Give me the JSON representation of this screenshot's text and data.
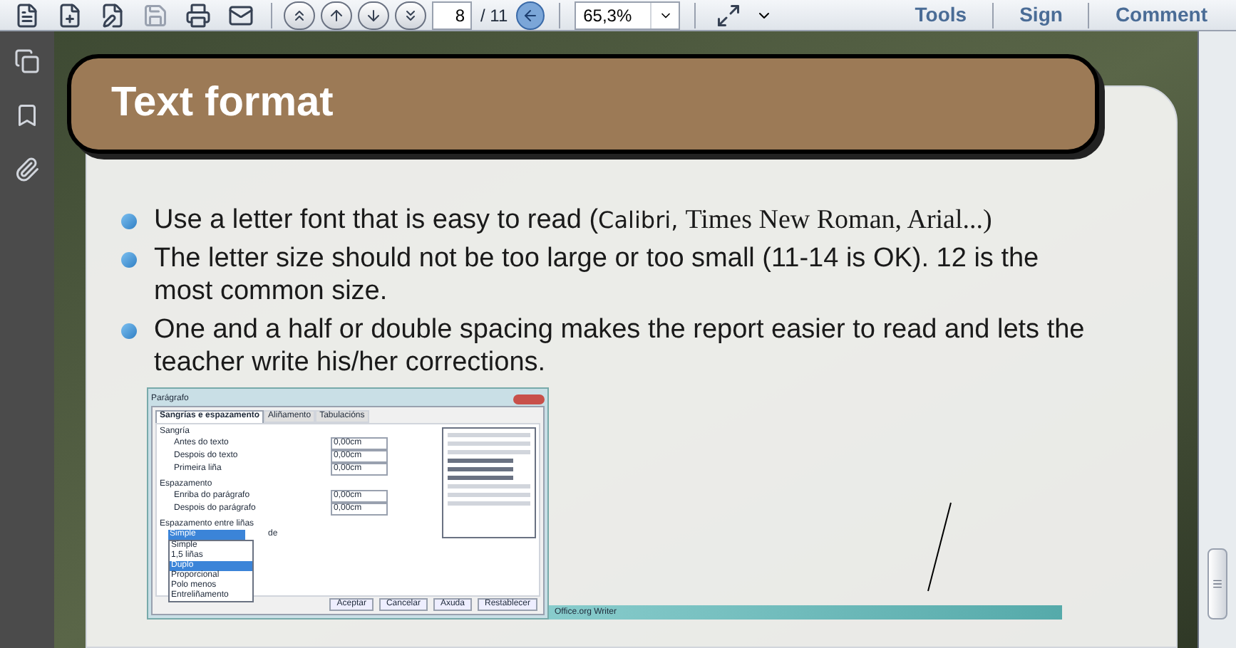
{
  "toolbar": {
    "page_number": "8",
    "page_total": "/ 11",
    "zoom": "65,3%",
    "links": [
      "Tools",
      "Sign",
      "Comment"
    ]
  },
  "slide": {
    "title": "Text format",
    "bullets": [
      {
        "text": "Use a letter font that is easy to read (",
        "fonts": [
          "Calibri,",
          "Times New Roman, Arial...)"
        ]
      },
      {
        "text": "The letter size should not be too large or too small (11-14 is OK). 12 is the most common size."
      },
      {
        "text": "One and a half or double spacing makes the report easier to read and lets the teacher write his/her corrections."
      }
    ],
    "dialog": {
      "title": "Parágrafo",
      "tabs": [
        {
          "label": "Sangrías e espazamento",
          "selected": true
        },
        {
          "label": "Aliñamento",
          "selected": false
        },
        {
          "label": "Tabulacións",
          "selected": false
        }
      ],
      "sections": [
        {
          "label": "Sangría",
          "rows": [
            {
              "label": "Antes do texto",
              "value": "0,00cm"
            },
            {
              "label": "Despois do texto",
              "value": "0,00cm"
            },
            {
              "label": "Primeira liña",
              "value": "0,00cm"
            }
          ]
        },
        {
          "label": "Espazamento",
          "rows": [
            {
              "label": "Enriba do parágrafo",
              "value": "0,00cm"
            },
            {
              "label": "Despois do parágrafo",
              "value": "0,00cm"
            }
          ]
        }
      ],
      "spacing_label": "Espazamento entre liñas",
      "spacing_value": "Simple",
      "de_label": "de",
      "options": [
        {
          "label": "Simple",
          "selected": false
        },
        {
          "label": "1,5 liñas",
          "selected": false
        },
        {
          "label": "Duplo",
          "selected": true
        },
        {
          "label": "Proporcional",
          "selected": false
        },
        {
          "label": "Polo menos",
          "selected": false
        },
        {
          "label": "Entreliñamento",
          "selected": false
        }
      ],
      "buttons": [
        "Aceptar",
        "Cancelar",
        "Axuda",
        "Restablecer"
      ]
    },
    "window_bar": {
      "title": "Office.org Writer"
    }
  }
}
